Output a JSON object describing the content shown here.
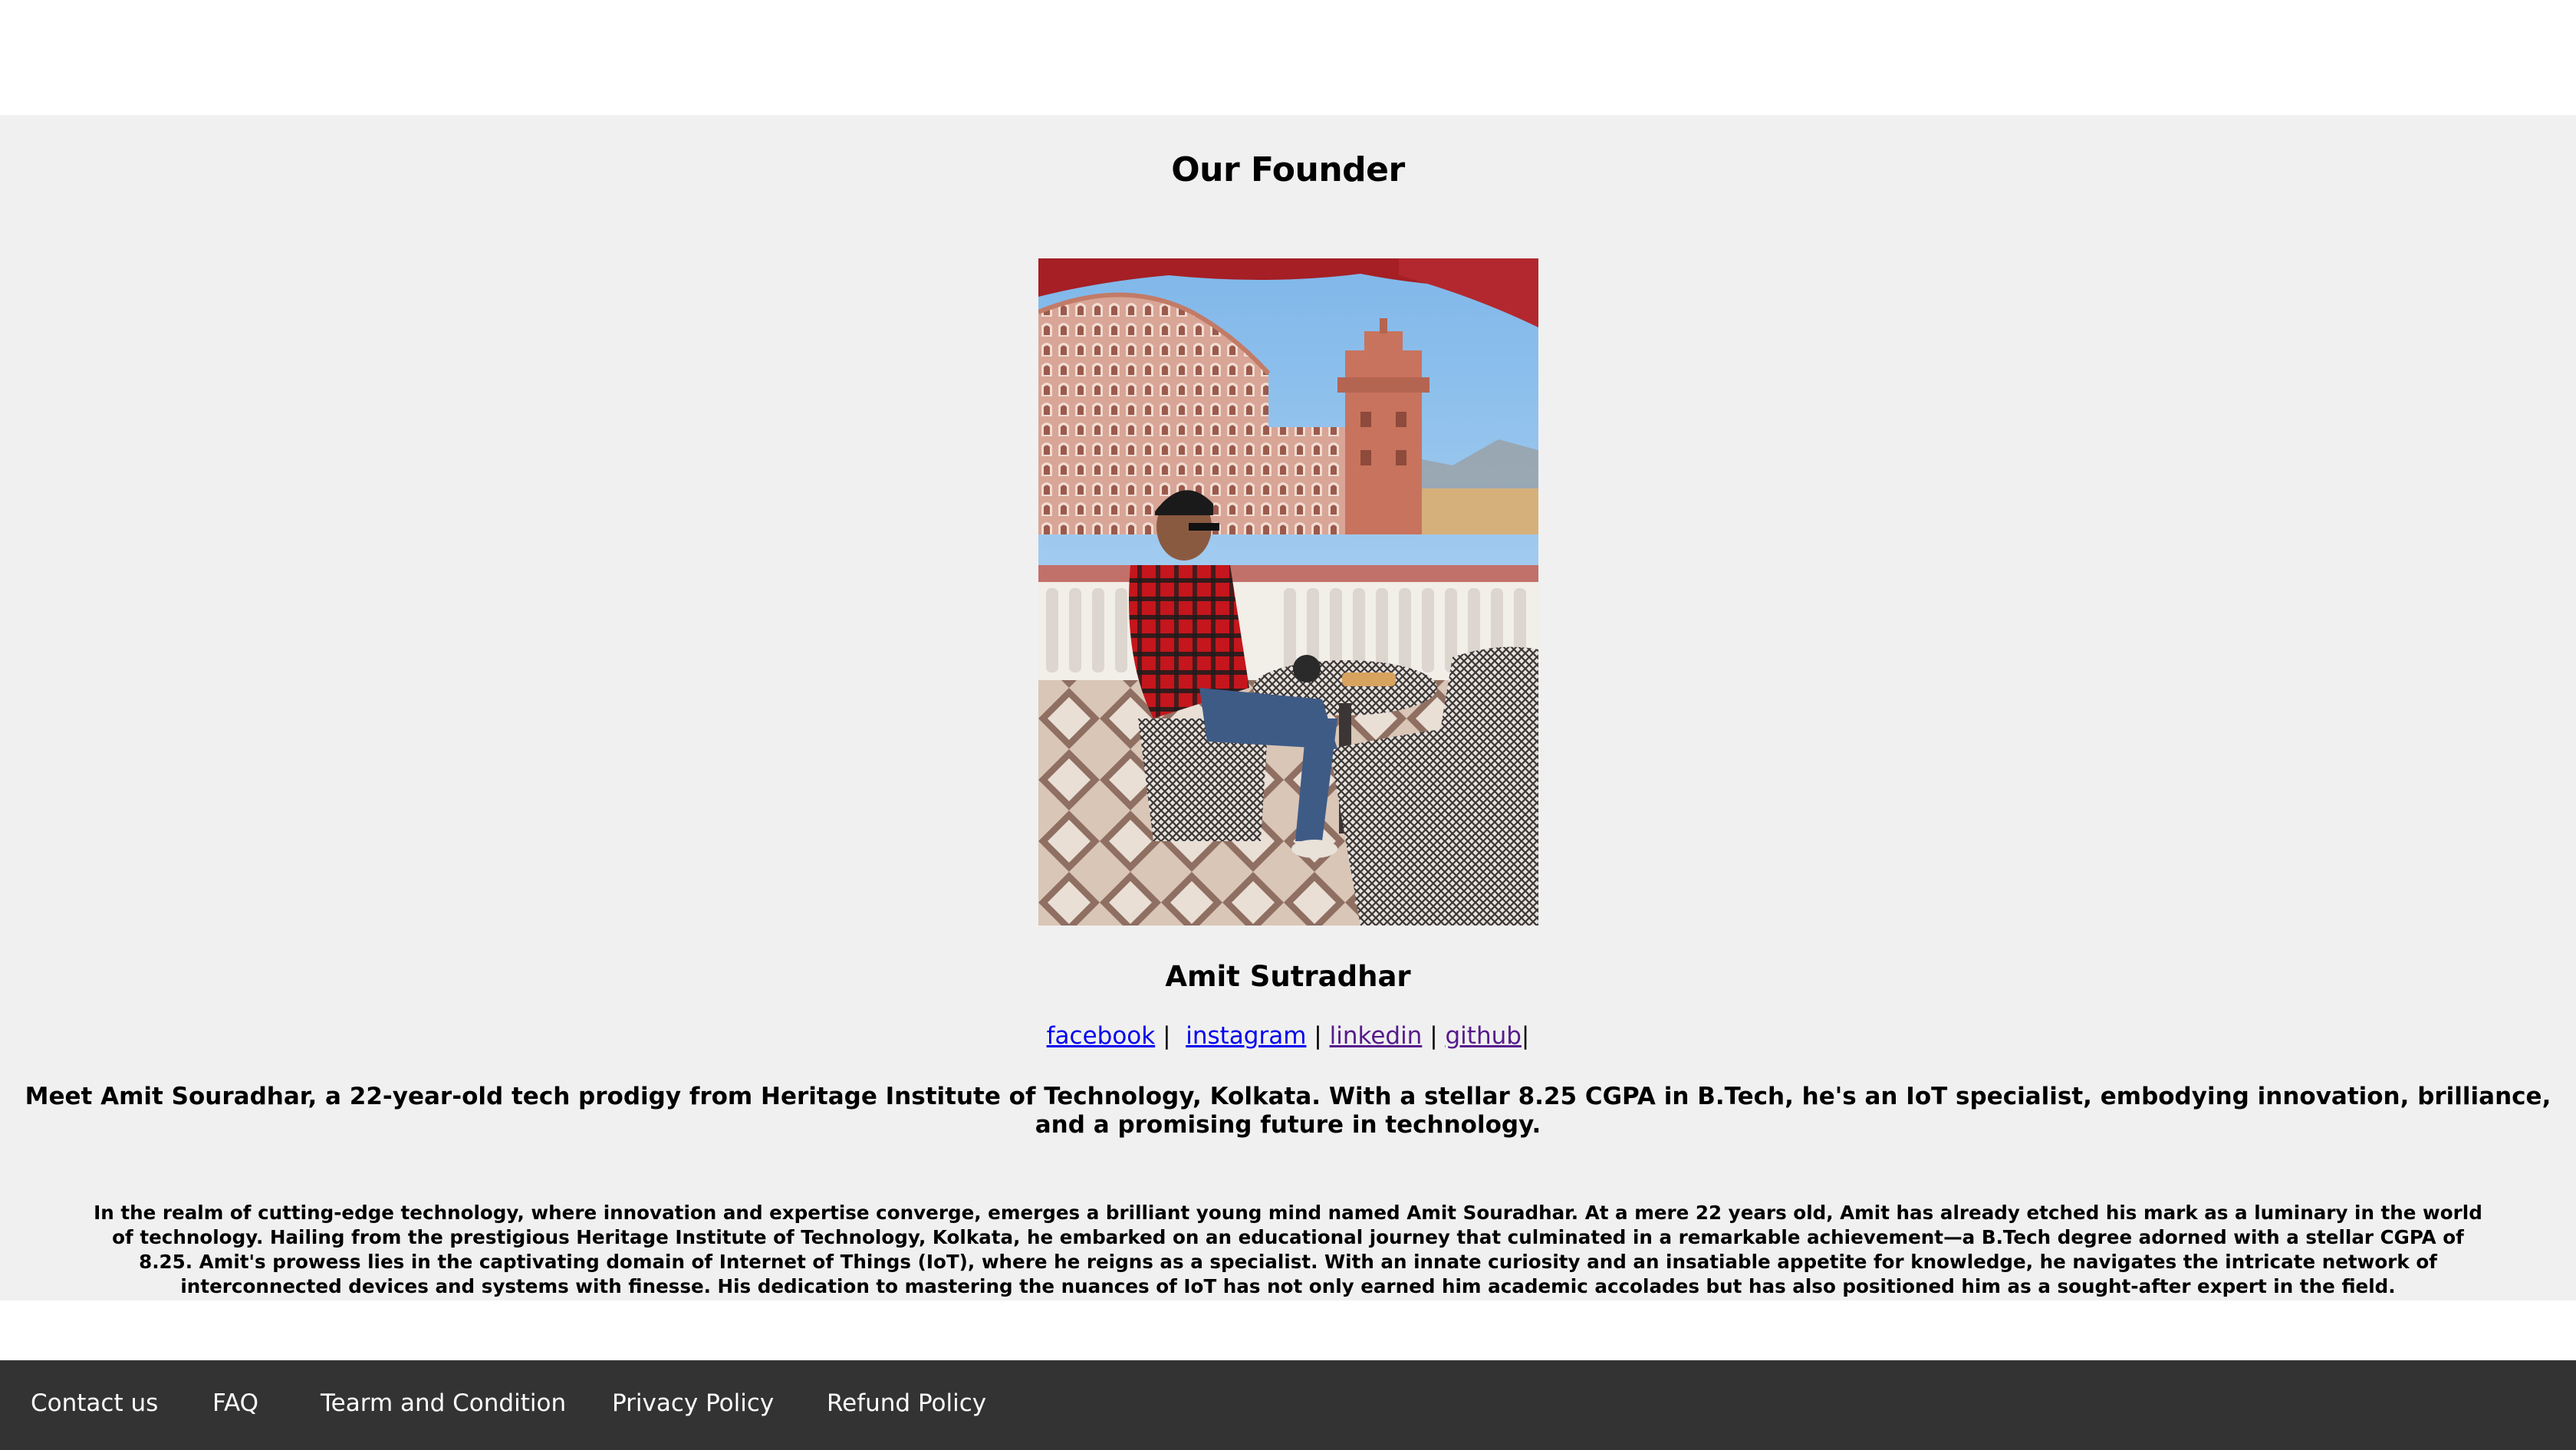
{
  "founder": {
    "heading": "Our Founder",
    "photo_alt": "Founder seated on a balcony overlooking Hawa Mahal, Jaipur",
    "name": "Amit Sutradhar",
    "social": {
      "facebook": "facebook",
      "instagram": "instagram",
      "linkedin": "linkedin",
      "github": "github",
      "separator": "|"
    },
    "intro": "Meet Amit Souradhar, a 22-year-old tech prodigy from Heritage Institute of Technology, Kolkata. With a stellar 8.25 CGPA in B.Tech, he's an IoT specialist, embodying innovation, brilliance, and a promising future in technology.",
    "bio": "In the realm of cutting-edge technology, where innovation and expertise converge, emerges a brilliant young mind named Amit Souradhar. At a mere 22 years old, Amit has already etched his mark as a luminary in the world of technology. Hailing from the prestigious Heritage Institute of Technology, Kolkata, he embarked on an educational journey that culminated in a remarkable achievement—a B.Tech degree adorned with a stellar CGPA of 8.25. Amit's prowess lies in the captivating domain of Internet of Things (IoT), where he reigns as a specialist. With an innate curiosity and an insatiable appetite for knowledge, he navigates the intricate network of interconnected devices and systems with finesse. His dedication to mastering the nuances of IoT has not only earned him academic accolades but has also positioned him as a sought-after expert in the field."
  },
  "footer": {
    "links": [
      "Contact us",
      "FAQ",
      "Tearm and Condition",
      "Privacy Policy",
      "Refund Policy"
    ]
  },
  "colors": {
    "section_bg": "#f0f0f0",
    "footer_bg": "#333333",
    "link": "#0000ee",
    "visited_link": "#551a8b"
  }
}
